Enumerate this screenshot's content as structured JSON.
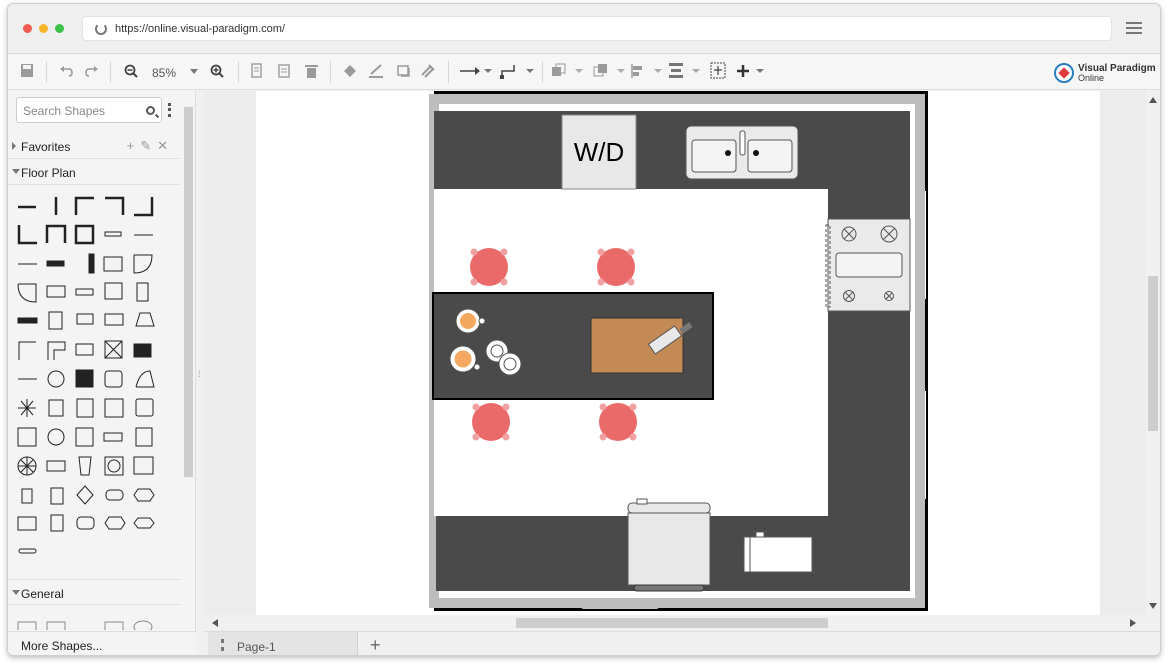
{
  "browser": {
    "url": "https://online.visual-paradigm.com/"
  },
  "toolbar": {
    "zoom": "85%",
    "brand_name": "Visual Paradigm",
    "brand_sub": "Online"
  },
  "sidebar": {
    "search_placeholder": "Search Shapes",
    "favorites_label": "Favorites",
    "floorplan_label": "Floor Plan",
    "general_label": "General",
    "more_shapes_label": "More Shapes..."
  },
  "diagram": {
    "washer_dryer_label": "W/D"
  },
  "pages": {
    "tabs": [
      "Page-1"
    ]
  },
  "icons": {
    "save": "save-icon",
    "undo": "undo-icon",
    "redo": "redo-icon",
    "zoom_out": "zoom-out-icon",
    "zoom_in": "zoom-in-icon",
    "copy": "copy-icon",
    "paste": "paste-icon",
    "delete": "trash-icon",
    "fill": "fill-color-icon",
    "line": "line-color-icon",
    "shadow": "shadow-icon",
    "format": "format-painter-icon",
    "connector": "connector-icon",
    "waypoint": "waypoint-icon",
    "to_front": "to-front-icon",
    "to_back": "to-back-icon",
    "align": "align-icon",
    "distribute": "distribute-icon",
    "fit": "fit-icon",
    "insert": "plus-icon"
  },
  "colors": {
    "counter": "#4a4a4a",
    "chair": "#ea6a6a",
    "cutting_board": "#c48a55",
    "plate_orange": "#f5a860",
    "wall": "#000000"
  }
}
